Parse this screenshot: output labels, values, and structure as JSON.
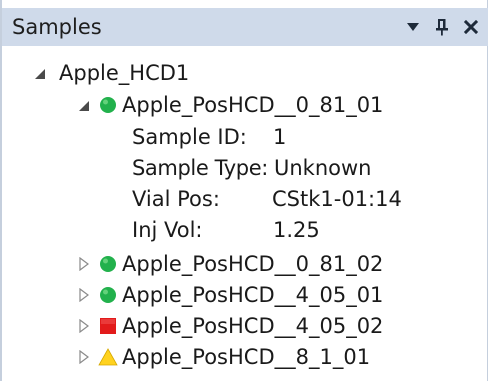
{
  "panel": {
    "title": "Samples",
    "buttons": {
      "dropdown_icon": "chevron-down-icon",
      "pin_icon": "pin-icon",
      "close_icon": "close-icon"
    }
  },
  "tree": {
    "root": {
      "label": "Apple_HCD1",
      "expanded": true
    },
    "samples": [
      {
        "label": "Apple_PosHCD__0_81_01",
        "status": "green-circle",
        "expanded": true,
        "properties": [
          {
            "key": "Sample ID:",
            "value": "1"
          },
          {
            "key": "Sample Type:",
            "value": "Unknown"
          },
          {
            "key": "Vial Pos:",
            "value": "CStk1-01:14"
          },
          {
            "key": "Inj Vol:",
            "value": "1.25"
          }
        ]
      },
      {
        "label": "Apple_PosHCD__0_81_02",
        "status": "green-circle",
        "expanded": false
      },
      {
        "label": "Apple_PosHCD__4_05_01",
        "status": "green-circle",
        "expanded": false
      },
      {
        "label": "Apple_PosHCD__4_05_02",
        "status": "red-square",
        "expanded": false
      },
      {
        "label": "Apple_PosHCD__8_1_01",
        "status": "yellow-triangle",
        "expanded": false
      }
    ]
  },
  "colors": {
    "header_bg": "#cfdaea",
    "status_green": "#22b14c",
    "status_red": "#e21b1b",
    "status_yellow": "#ffd21f"
  }
}
